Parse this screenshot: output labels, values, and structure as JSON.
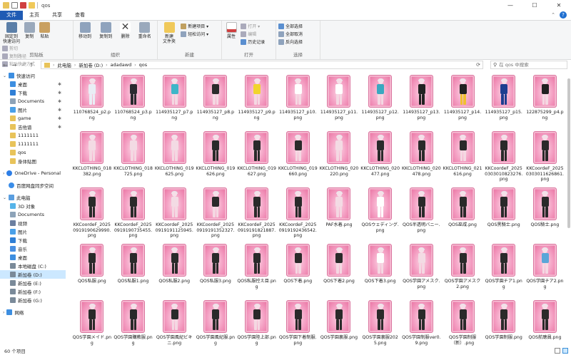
{
  "titlebar": {
    "title": "qos",
    "min": "—",
    "max": "☐",
    "close": "✕"
  },
  "tabs": [
    {
      "label": "文件",
      "active": true
    },
    {
      "label": "主页",
      "active": false
    },
    {
      "label": "共享",
      "active": false
    },
    {
      "label": "查看",
      "active": false
    }
  ],
  "ribbon": {
    "clipboard": {
      "label": "剪贴板",
      "pin": "固定到\n快速访问",
      "copy": "复制",
      "paste": "粘贴",
      "cut": "剪切",
      "copy_path": "复制路径",
      "paste_shortcut": "粘贴快捷方式"
    },
    "organize": {
      "label": "组织",
      "move_to": "移动到",
      "copy_to": "复制到",
      "delete": "删除",
      "rename": "重命名"
    },
    "new": {
      "label": "新建",
      "new_folder": "新建\n文件夹",
      "new_item": "新建项目 ▾",
      "easy_access": "轻松访问 ▾"
    },
    "open": {
      "label": "打开",
      "properties": "属性",
      "open": "打开 ▾",
      "edit": "编辑",
      "history": "历史记录"
    },
    "select": {
      "label": "选择",
      "select_all": "全部选择",
      "select_none": "全部取消",
      "invert": "反向选择"
    }
  },
  "address": {
    "crumbs": [
      "此电脑",
      "新加卷 (D:)",
      "adadawd",
      "qos"
    ],
    "search_placeholder": "在 qos 中搜索"
  },
  "nav": {
    "quick_access": "快速访问",
    "quick_items": [
      {
        "label": "桌面",
        "icon": "desktop-icon",
        "color": "#3d8ee0"
      },
      {
        "label": "下载",
        "icon": "download-icon",
        "color": "#2f7fd6"
      },
      {
        "label": "Documents",
        "icon": "documents-icon",
        "color": "#8da3b8"
      },
      {
        "label": "图片",
        "icon": "pictures-icon",
        "color": "#4aa0e8"
      },
      {
        "label": "game",
        "icon": "folder-icon",
        "color": "#e8c35a"
      },
      {
        "label": "吉他谱",
        "icon": "folder-icon",
        "color": "#e8c35a"
      },
      {
        "label": "1111111",
        "icon": "folder-icon",
        "color": "#e8c35a"
      },
      {
        "label": "1111111",
        "icon": "folder-icon",
        "color": "#e8c35a"
      },
      {
        "label": "qos",
        "icon": "folder-icon",
        "color": "#e8c35a"
      },
      {
        "label": "身体贴图",
        "icon": "folder-icon",
        "color": "#e8c35a"
      }
    ],
    "onedrive": "OneDrive - Personal",
    "baidu": "百度网盘同步空间",
    "this_pc": "此电脑",
    "pc_items": [
      {
        "label": "3D 对象",
        "icon": "3d-objects-icon",
        "color": "#56b4e9"
      },
      {
        "label": "Documents",
        "icon": "documents-icon",
        "color": "#8da3b8"
      },
      {
        "label": "视频",
        "icon": "videos-icon",
        "color": "#6b7fa0"
      },
      {
        "label": "图片",
        "icon": "pictures-icon",
        "color": "#4aa0e8"
      },
      {
        "label": "下载",
        "icon": "download-icon",
        "color": "#2f7fd6"
      },
      {
        "label": "音乐",
        "icon": "music-icon",
        "color": "#4a90e2"
      },
      {
        "label": "桌面",
        "icon": "desktop-icon",
        "color": "#3d8ee0"
      },
      {
        "label": "本地磁盘 (C:)",
        "icon": "drive-icon",
        "color": "#7a8a99"
      },
      {
        "label": "新加卷 (D:)",
        "icon": "drive-icon",
        "color": "#7a8a99"
      },
      {
        "label": "新加卷 (E:)",
        "icon": "drive-icon",
        "color": "#7a8a99"
      },
      {
        "label": "新加卷 (F:)",
        "icon": "drive-icon",
        "color": "#7a8a99"
      },
      {
        "label": "新加卷 (G:)",
        "icon": "drive-icon",
        "color": "#7a8a99"
      }
    ],
    "network": "网络"
  },
  "files": [
    {
      "name": "110768524_p2.png",
      "outfit": "#e9eef5",
      "legs": "#e9eef5",
      "hair": "#e8e8ec"
    },
    {
      "name": "110768524_p3.png",
      "outfit": "#2a2a30",
      "legs": "#2a2a30",
      "hair": "#e8e8ec"
    },
    {
      "name": "114935127_p7.png",
      "outfit": "#3fb6c8",
      "legs": "#f4d8e2",
      "hair": "#e8e8ec"
    },
    {
      "name": "114935127_p8.png",
      "outfit": "#2b2b2b",
      "legs": "#f4d8e2",
      "hair": "#e8e8ec"
    },
    {
      "name": "114935127_p9.png",
      "outfit": "#f1d52d",
      "legs": "#f4d8e2",
      "hair": "#e8e8ec"
    },
    {
      "name": "114935127_p10.png",
      "outfit": "#ffffff",
      "legs": "#f4d8e2",
      "hair": "#e8e8ec"
    },
    {
      "name": "114935127_p11.png",
      "outfit": "#ffffff",
      "legs": "#f4d8e2",
      "hair": "#e8e8ec"
    },
    {
      "name": "114935127_p12.png",
      "outfit": "#3aa8c0",
      "legs": "#f4d8e2",
      "hair": "#e8e8ec"
    },
    {
      "name": "114935127_p13.png",
      "outfit": "#222222",
      "legs": "#222222",
      "hair": "#e8e8ec"
    },
    {
      "name": "114935127_p14.png",
      "outfit": "#222222",
      "legs": "#f0c030",
      "hair": "#e8e8ec"
    },
    {
      "name": "114935127_p15.png",
      "outfit": "#1e3e90",
      "legs": "#1e3e90",
      "hair": "#e8e8ec"
    },
    {
      "name": "122875299_p4.png",
      "outfit": "#202020",
      "legs": "#f4d8e2",
      "hair": "#e8e8ec"
    },
    {
      "name": "KKCLOTHING_018382.png",
      "outfit": "#f3dbe4",
      "legs": "#f4d8e2",
      "hair": "#e8e8ec"
    },
    {
      "name": "KKCLOTHING_018725.png",
      "outfit": "#f3dbe4",
      "legs": "#f4d8e2",
      "hair": "#e8e8ec"
    },
    {
      "name": "KKCLOTHING_019625.png",
      "outfit": "#f3dbe4",
      "legs": "#f4d8e2",
      "hair": "#e8e8ec"
    },
    {
      "name": "KKCLOTHING_019626.png",
      "outfit": "#2a2a2a",
      "legs": "#2a2a2a",
      "hair": "#e8e8ec"
    },
    {
      "name": "KKCLOTHING_019627.png",
      "outfit": "#2a2a2a",
      "legs": "#2a2a2a",
      "hair": "#e8e8ec"
    },
    {
      "name": "KKCLOTHING_019660.png",
      "outfit": "#2a2a2a",
      "legs": "#f4d8e2",
      "hair": "#e8e8ec"
    },
    {
      "name": "KKCLOTHING_020220.png",
      "outfit": "#f3dbe4",
      "legs": "#f4d8e2",
      "hair": "#e8e8ec"
    },
    {
      "name": "KKCLOTHING_020477.png",
      "outfit": "#2a2a2a",
      "legs": "#2a2a2a",
      "hair": "#e8e8ec"
    },
    {
      "name": "KKCLOTHING_020478.png",
      "outfit": "#2a2a2a",
      "legs": "#2a2a2a",
      "hair": "#e8e8ec"
    },
    {
      "name": "KKCLOTHING_021616.png",
      "outfit": "#2a2a2a",
      "legs": "#f4d8e2",
      "hair": "#e8e8ec"
    },
    {
      "name": "KKCoordeF_20250303010823276.png",
      "outfit": "#2a2a2a",
      "legs": "#2a2a2a",
      "hair": "#e8e8ec"
    },
    {
      "name": "KKCoordeF_20250303011626861.png",
      "outfit": "#2a2a2a",
      "legs": "#2a2a2a",
      "hair": "#e8e8ec"
    },
    {
      "name": "KKCoordeF_20250919190629990.png",
      "outfit": "#2a2a2a",
      "legs": "#2a2a2a",
      "hair": "#e8e8ec"
    },
    {
      "name": "KKCoordeF_20250919190735455.png",
      "outfit": "#2a2a2a",
      "legs": "#2a2a2a",
      "hair": "#e8e8ec"
    },
    {
      "name": "KKCoordeF_20250919191125945.png",
      "outfit": "#f3dbe4",
      "legs": "#f4d8e2",
      "hair": "#e8e8ec"
    },
    {
      "name": "KKCoordeF_20250919191352327.png",
      "outfit": "#2a2a2a",
      "legs": "#f4d8e2",
      "hair": "#e8e8ec"
    },
    {
      "name": "KKCoordeF_20250919191821887.png",
      "outfit": "#2a2a2a",
      "legs": "#2a2a2a",
      "hair": "#e8e8ec"
    },
    {
      "name": "KKCoordeF_20250919192436542.png",
      "outfit": "#2a2a2a",
      "legs": "#2a2a2a",
      "hair": "#e8e8ec"
    },
    {
      "name": "PAF水着.png",
      "outfit": "#f3dbe4",
      "legs": "#f4d8e2",
      "hair": "#e8e8ec"
    },
    {
      "name": "QOSウェディング.png",
      "outfit": "#ffffff",
      "legs": "#ffffff",
      "hair": "#e8e8ec"
    },
    {
      "name": "QOS半透明バニー.png",
      "outfit": "#2a2a2a",
      "legs": "#2a2a2a",
      "hair": "#e8e8ec"
    },
    {
      "name": "QOS巫咸.png",
      "outfit": "#2a2a2a",
      "legs": "#2a2a2a",
      "hair": "#e8e8ec"
    },
    {
      "name": "QOS黑騎士.png",
      "outfit": "#2a2a2a",
      "legs": "#2a2a2a",
      "hair": "#e8e8ec"
    },
    {
      "name": "QOS騎士.png",
      "outfit": "#2a2a2a",
      "legs": "#2a2a2a",
      "hair": "#e8e8ec"
    },
    {
      "name": "QOS私服.png",
      "outfit": "#2a2a2a",
      "legs": "#2a2a2a",
      "hair": "#e8e8ec"
    },
    {
      "name": "QOS私服1.png",
      "outfit": "#2a2a2a",
      "legs": "#2a2a2a",
      "hair": "#e8e8ec"
    },
    {
      "name": "QOS私服2.png",
      "outfit": "#2a2a2a",
      "legs": "#2a2a2a",
      "hair": "#e8e8ec"
    },
    {
      "name": "QOS私服3.png",
      "outfit": "#2a2a2a",
      "legs": "#2a2a2a",
      "hair": "#e8e8ec"
    },
    {
      "name": "QOS私服控え目.png",
      "outfit": "#2a2a2a",
      "legs": "#2a2a2a",
      "hair": "#e8e8ec"
    },
    {
      "name": "QOS下着.png",
      "outfit": "#2a2a2a",
      "legs": "#f4d8e2",
      "hair": "#e8e8ec"
    },
    {
      "name": "QOS下着2.png",
      "outfit": "#2a2a2a",
      "legs": "#f4d8e2",
      "hair": "#e8e8ec"
    },
    {
      "name": "QOS下着3.png",
      "outfit": "#ffffff",
      "legs": "#f4d8e2",
      "hair": "#e8e8ec"
    },
    {
      "name": "QOS学園アメスク.png",
      "outfit": "#f3dbe4",
      "legs": "#f4d8e2",
      "hair": "#e8e8ec"
    },
    {
      "name": "QOS学園アメスク2.png",
      "outfit": "#2a2a2a",
      "legs": "#2a2a2a",
      "hair": "#e8e8ec"
    },
    {
      "name": "QOS学園チア1.png",
      "outfit": "#2a2a2a",
      "legs": "#2a2a2a",
      "hair": "#e8e8ec"
    },
    {
      "name": "QOS学園チア2.png",
      "outfit": "#5aa6d8",
      "legs": "#f4d8e2",
      "hair": "#e8e8ec"
    },
    {
      "name": "QOS学園メイド.png",
      "outfit": "#2a2a2a",
      "legs": "#2a2a2a",
      "hair": "#e8e8ec"
    },
    {
      "name": "QOS学園購教服.png",
      "outfit": "#2a2a2a",
      "legs": "#2a2a2a",
      "hair": "#e8e8ec"
    },
    {
      "name": "QOS学園風紀ビキニ.png",
      "outfit": "#2a2a2a",
      "legs": "#f4d8e2",
      "hair": "#e8e8ec"
    },
    {
      "name": "QOS学園風紀服.png",
      "outfit": "#2a2a2a",
      "legs": "#2a2a2a",
      "hair": "#e8e8ec"
    },
    {
      "name": "QOS学園陸上部.png",
      "outfit": "#2a2a2a",
      "legs": "#f4d8e2",
      "hair": "#e8e8ec"
    },
    {
      "name": "QOS学園下着制服.png",
      "outfit": "#2a2a2a",
      "legs": "#2a2a2a",
      "hair": "#e8e8ec"
    },
    {
      "name": "QOS学園裏服.png",
      "outfit": "#2a2a2a",
      "legs": "#2a2a2a",
      "hair": "#e8e8ec"
    },
    {
      "name": "QOS学園裏服2025.png",
      "outfit": "#2a2a2a",
      "legs": "#2a2a2a",
      "hair": "#e8e8ec"
    },
    {
      "name": "QOS学園制服ver0.9.png",
      "outfit": "#2a2a2a",
      "legs": "#2a2a2a",
      "hair": "#e8e8ec"
    },
    {
      "name": "QOS学園制服（新）.png",
      "outfit": "#2a2a2a",
      "legs": "#2a2a2a",
      "hair": "#e8e8ec"
    },
    {
      "name": "QOS学園制服.png",
      "outfit": "#2a2a2a",
      "legs": "#2a2a2a",
      "hair": "#e8e8ec"
    },
    {
      "name": "QOS航聴員.png",
      "outfit": "#2a2a2a",
      "legs": "#2a2a2a",
      "hair": "#e8e8ec"
    }
  ],
  "status": {
    "count": "60 个项目"
  }
}
